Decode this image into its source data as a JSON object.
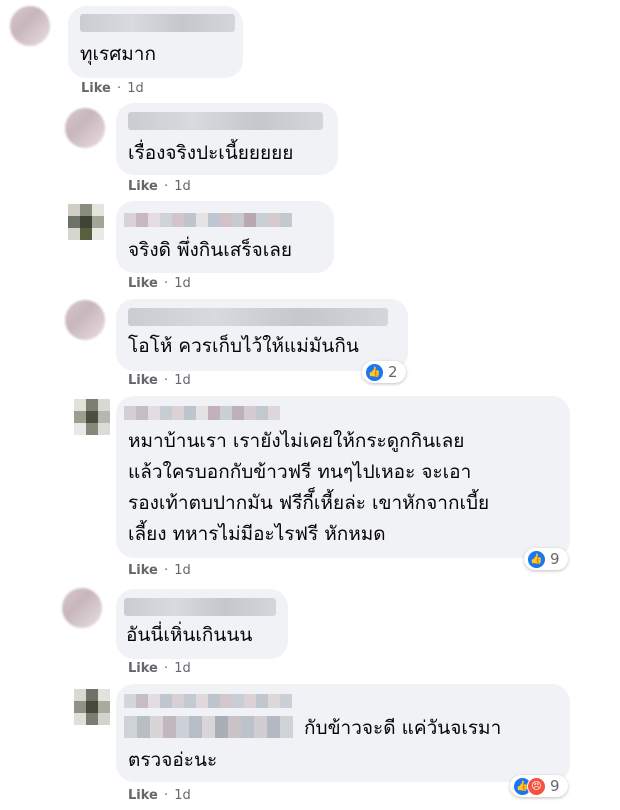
{
  "comments": [
    {
      "text": [
        "ทุเรศมาก"
      ],
      "like_label": "Like",
      "time": "1d"
    },
    {
      "text": [
        "เรื่องจริงปะเนี้ยยยยย"
      ],
      "like_label": "Like",
      "time": "1d"
    },
    {
      "text": [
        "จริงดิ พึ่งกินเสร็จเลย"
      ],
      "like_label": "Like",
      "time": "1d"
    },
    {
      "text": [
        "โอโห้ ควรเก็บไว้ให้แม่มันกิน"
      ],
      "like_label": "Like",
      "time": "1d",
      "reaction_count": "2",
      "reaction_icons": [
        "like-icon"
      ]
    },
    {
      "text": [
        "หมาบ้านเรา เรายังไม่เคยให้กระดูกกินเลย",
        "แล้วใครบอกกับข้าวฟรี ทนๆไปเหอะ จะเอา",
        "รองเท้าตบปากมัน ฟรีกี็เหี้ยล่ะ เขาหักจากเบี้ย",
        "เลี้ยง ทหารไม่มีอะไรฟรี หักหมด"
      ],
      "like_label": "Like",
      "time": "1d",
      "reaction_count": "9",
      "reaction_icons": [
        "like-icon"
      ]
    },
    {
      "text": [
        "อันนี่เหิ่นเกินนน"
      ],
      "like_label": "Like",
      "time": "1d"
    },
    {
      "text": [
        "กับข้าวจะดี แค่วันจเรมา",
        "ตรวจอ่ะนะ"
      ],
      "like_label": "Like",
      "time": "1d",
      "reaction_count": "9",
      "reaction_icons": [
        "like-icon",
        "angry-icon"
      ]
    }
  ],
  "colors": {
    "bubble": "#f0f2f5",
    "meta": "#65676b",
    "like_reaction": "#1877f2",
    "angry_reaction": "#f5533d"
  }
}
